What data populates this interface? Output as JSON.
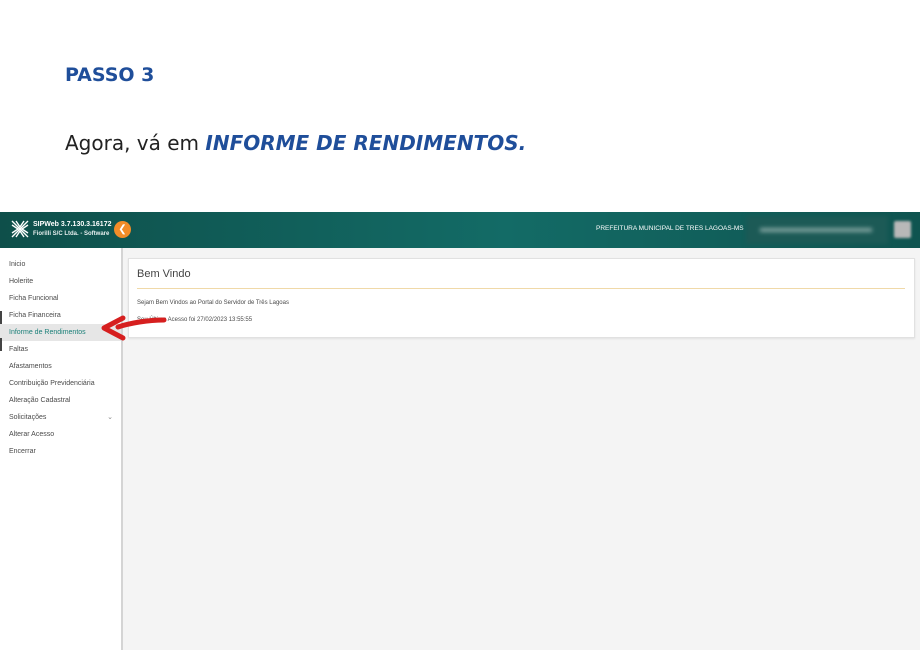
{
  "document": {
    "step_heading": "PASSO 3",
    "instruction_prefix": "Agora, vá em ",
    "instruction_emphasis": "INFORME DE RENDIMENTOS."
  },
  "app": {
    "logo_line1": "SIPWeb 3.7.130.3.16172",
    "logo_line2": "Fiorilli S/C Ltda. - Software",
    "organization": "PREFEITURA MUNICIPAL DE TRES LAGOAS-MS",
    "collapse_icon": "chevron-left-icon",
    "brand_color": "#136b66",
    "accent_color": "#f28c28"
  },
  "sidebar": {
    "items": [
      {
        "label": "Inicio"
      },
      {
        "label": "Holerite"
      },
      {
        "label": "Ficha Funcional"
      },
      {
        "label": "Ficha Financeira"
      },
      {
        "label": "Informe de Rendimentos",
        "active": true
      },
      {
        "label": "Faltas"
      },
      {
        "label": "Afastamentos"
      },
      {
        "label": "Contribuição Previdenciária"
      },
      {
        "label": "Alteração Cadastral"
      },
      {
        "label": "Solicitações",
        "expandable": true
      },
      {
        "label": "Alterar Acesso"
      },
      {
        "label": "Encerrar"
      }
    ]
  },
  "main": {
    "title": "Bem Vindo",
    "welcome_text": "Sejam Bem Vindos ao Portal do Servidor de Três Lagoas",
    "last_access": "Seu Último Acesso foi 27/02/2023 13:55:55"
  },
  "annotation": {
    "arrow_color": "#d61f1f",
    "arrow_icon": "red-arrow-pointer"
  }
}
